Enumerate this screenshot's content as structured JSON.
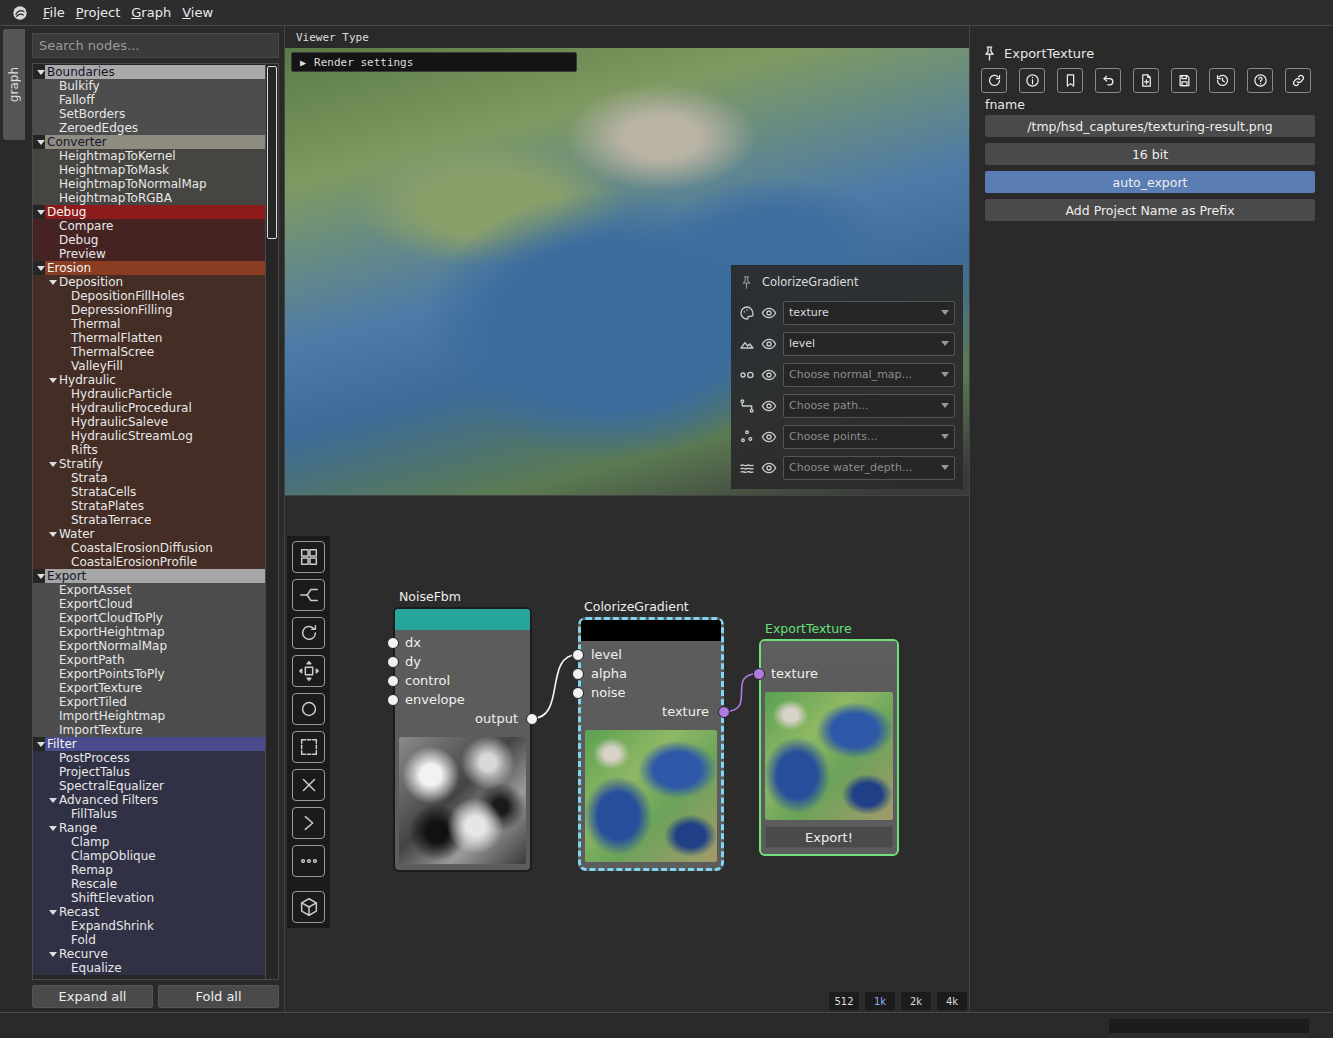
{
  "menu": [
    "File",
    "Project",
    "Graph",
    "View"
  ],
  "side_tabs": [
    {
      "label": "graph",
      "selected": true
    }
  ],
  "search": {
    "placeholder": "Search nodes..."
  },
  "tree": {
    "scroll": {
      "level": 0.19
    },
    "categories": [
      {
        "name": "Boundaries",
        "color": "#a9a9a9",
        "expanded": true,
        "items": [
          {
            "name": "Bulkify",
            "kind": "leaf"
          },
          {
            "name": "Falloff",
            "kind": "leaf"
          },
          {
            "name": "SetBorders",
            "kind": "leaf"
          },
          {
            "name": "ZeroedEdges",
            "kind": "leaf"
          }
        ]
      },
      {
        "name": "Converter",
        "color": "#8f8d82",
        "expanded": true,
        "items": [
          {
            "name": "HeightmapToKernel",
            "kind": "leaf"
          },
          {
            "name": "HeightmapToMask",
            "kind": "leaf"
          },
          {
            "name": "HeightmapToNormalMap",
            "kind": "leaf"
          },
          {
            "name": "HeightmapToRGBA",
            "kind": "leaf"
          }
        ]
      },
      {
        "name": "Debug",
        "color": "#8e1b1b",
        "expanded": true,
        "items": [
          {
            "name": "Compare",
            "kind": "leaf"
          },
          {
            "name": "Debug",
            "kind": "leaf"
          },
          {
            "name": "Preview",
            "kind": "leaf"
          }
        ]
      },
      {
        "name": "Erosion",
        "color": "#8a3d22",
        "expanded": true,
        "items": [
          {
            "name": "Deposition",
            "kind": "group",
            "expanded": true,
            "items": [
              {
                "name": "DepositionFillHoles",
                "kind": "leaf"
              },
              {
                "name": "DepressionFilling",
                "kind": "leaf"
              },
              {
                "name": "Thermal",
                "kind": "leaf"
              },
              {
                "name": "ThermalFlatten",
                "kind": "leaf"
              },
              {
                "name": "ThermalScree",
                "kind": "leaf"
              },
              {
                "name": "ValleyFill",
                "kind": "leaf"
              }
            ]
          },
          {
            "name": "Hydraulic",
            "kind": "group",
            "expanded": true,
            "items": [
              {
                "name": "HydraulicParticle",
                "kind": "leaf"
              },
              {
                "name": "HydraulicProcedural",
                "kind": "leaf"
              },
              {
                "name": "HydraulicSaleve",
                "kind": "leaf"
              },
              {
                "name": "HydraulicStreamLog",
                "kind": "leaf"
              },
              {
                "name": "Rifts",
                "kind": "leaf"
              }
            ]
          },
          {
            "name": "Stratify",
            "kind": "group",
            "expanded": true,
            "items": [
              {
                "name": "Strata",
                "kind": "leaf"
              },
              {
                "name": "StrataCells",
                "kind": "leaf"
              },
              {
                "name": "StrataPlates",
                "kind": "leaf"
              },
              {
                "name": "StrataTerrace",
                "kind": "leaf"
              }
            ]
          },
          {
            "name": "Water",
            "kind": "group",
            "expanded": true,
            "items": [
              {
                "name": "CoastalErosionDiffusion",
                "kind": "leaf"
              },
              {
                "name": "CoastalErosionProfile",
                "kind": "leaf"
              }
            ]
          }
        ]
      },
      {
        "name": "Export",
        "color": "#a6a6a6",
        "expanded": true,
        "items": [
          {
            "name": "ExportAsset",
            "kind": "leaf"
          },
          {
            "name": "ExportCloud",
            "kind": "leaf"
          },
          {
            "name": "ExportCloudToPly",
            "kind": "leaf"
          },
          {
            "name": "ExportHeightmap",
            "kind": "leaf"
          },
          {
            "name": "ExportNormalMap",
            "kind": "leaf"
          },
          {
            "name": "ExportPath",
            "kind": "leaf"
          },
          {
            "name": "ExportPointsToPly",
            "kind": "leaf"
          },
          {
            "name": "ExportTexture",
            "kind": "leaf"
          },
          {
            "name": "ExportTiled",
            "kind": "leaf"
          },
          {
            "name": "ImportHeightmap",
            "kind": "leaf"
          },
          {
            "name": "ImportTexture",
            "kind": "leaf"
          }
        ]
      },
      {
        "name": "Filter",
        "color": "#4b4a8c",
        "expanded": true,
        "items": [
          {
            "name": "PostProcess",
            "kind": "leaf"
          },
          {
            "name": "ProjectTalus",
            "kind": "leaf"
          },
          {
            "name": "SpectralEqualizer",
            "kind": "leaf"
          },
          {
            "name": "Advanced Filters",
            "kind": "group",
            "expanded": true,
            "items": [
              {
                "name": "FillTalus",
                "kind": "leaf"
              }
            ]
          },
          {
            "name": "Range",
            "kind": "group",
            "expanded": true,
            "items": [
              {
                "name": "Clamp",
                "kind": "leaf"
              },
              {
                "name": "ClampOblique",
                "kind": "leaf"
              },
              {
                "name": "Remap",
                "kind": "leaf"
              },
              {
                "name": "Rescale",
                "kind": "leaf"
              },
              {
                "name": "ShiftElevation",
                "kind": "leaf"
              }
            ]
          },
          {
            "name": "Recast",
            "kind": "group",
            "expanded": true,
            "items": [
              {
                "name": "ExpandShrink",
                "kind": "leaf"
              },
              {
                "name": "Fold",
                "kind": "leaf"
              }
            ]
          },
          {
            "name": "Recurve",
            "kind": "group",
            "expanded": true,
            "items": [
              {
                "name": "Equalize",
                "kind": "leaf"
              }
            ]
          }
        ]
      }
    ]
  },
  "tree_buttons": [
    "Expand all",
    "Fold all"
  ],
  "viewer": {
    "title": "Viewer Type",
    "render_settings": {
      "icon": "▶",
      "label": "Render settings",
      "expanded": false
    }
  },
  "layers_panel": {
    "title": "ColorizeGradient",
    "rows": [
      {
        "text": "texture",
        "placeholder": false,
        "visible": true
      },
      {
        "text": "level",
        "placeholder": false,
        "visible": true
      },
      {
        "text": "Choose normal_map...",
        "placeholder": true,
        "visible": true
      },
      {
        "text": "Choose path...",
        "placeholder": true,
        "visible": true
      },
      {
        "text": "Choose points...",
        "placeholder": true,
        "visible": true
      },
      {
        "text": "Choose water_depth...",
        "placeholder": true,
        "visible": true
      }
    ]
  },
  "graph": {
    "nodes": [
      {
        "title": "NoiseFbm",
        "header_color": "#26a69a",
        "selected": false,
        "active": false,
        "inputs": [
          {
            "name": "dx",
            "kind": "heightmap"
          },
          {
            "name": "dy",
            "kind": "heightmap"
          },
          {
            "name": "control",
            "kind": "heightmap"
          },
          {
            "name": "envelope",
            "kind": "heightmap"
          }
        ],
        "outputs": [
          {
            "name": "output",
            "kind": "heightmap"
          }
        ],
        "preview": "heightmap"
      },
      {
        "title": "ColorizeGradient",
        "header_color": "#000000",
        "selected": true,
        "active": false,
        "inputs": [
          {
            "name": "level",
            "kind": "heightmap"
          },
          {
            "name": "alpha",
            "kind": "heightmap"
          },
          {
            "name": "noise",
            "kind": "heightmap"
          }
        ],
        "outputs": [
          {
            "name": "texture",
            "kind": "texture"
          }
        ],
        "preview": "texture"
      },
      {
        "title": "ExportTexture",
        "header_color": "#5e5e5e",
        "selected": false,
        "active": true,
        "inputs": [
          {
            "name": "texture",
            "kind": "texture"
          }
        ],
        "outputs": [],
        "preview": "texture",
        "button": "Export!"
      }
    ],
    "links": [
      {
        "from": "NoiseFbm",
        "from_port": "output",
        "to": "ColorizeGradient",
        "to_port": "level",
        "kind": "heightmap"
      },
      {
        "from": "ColorizeGradient",
        "from_port": "texture",
        "to": "ExportTexture",
        "to_port": "texture",
        "kind": "texture"
      }
    ],
    "resolutions": [
      {
        "label": "512",
        "selected": false
      },
      {
        "label": "1k",
        "selected": true
      },
      {
        "label": "2k",
        "selected": false
      },
      {
        "label": "4k",
        "selected": false
      }
    ]
  },
  "inspector": {
    "title": "ExportTexture",
    "section": "fname",
    "fields": [
      {
        "kind": "field",
        "text": "/tmp/hsd_captures/texturing-result.png",
        "on": false
      },
      {
        "kind": "button",
        "text": "16 bit",
        "on": false
      },
      {
        "kind": "toggle",
        "text": "auto_export",
        "on": true
      },
      {
        "kind": "button",
        "text": "Add Project Name as Prefix",
        "on": false
      }
    ]
  },
  "status_bar": {
    "progress": {
      "level": 0
    }
  }
}
